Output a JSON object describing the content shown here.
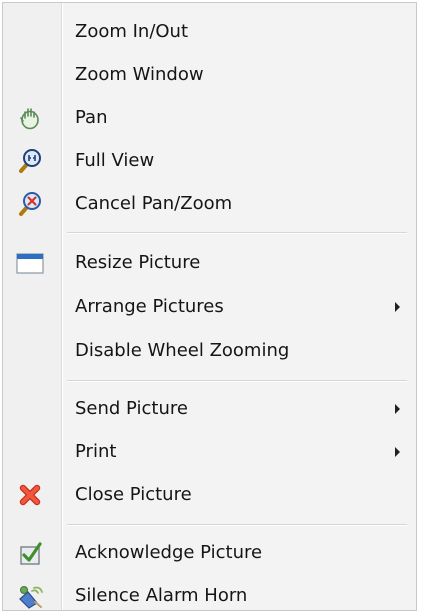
{
  "menu": {
    "items": [
      {
        "label": "Zoom In/Out",
        "icon": null,
        "submenu": false
      },
      {
        "label": "Zoom Window",
        "icon": null,
        "submenu": false
      },
      {
        "label": "Pan",
        "icon": "hand-icon",
        "submenu": false
      },
      {
        "label": "Full View",
        "icon": "full-view-magnifier-icon",
        "submenu": false
      },
      {
        "label": "Cancel Pan/Zoom",
        "icon": "cancel-zoom-magnifier-icon",
        "submenu": false
      },
      {
        "label": "Resize Picture",
        "icon": "window-icon",
        "submenu": false
      },
      {
        "label": "Arrange Pictures",
        "icon": null,
        "submenu": true
      },
      {
        "label": "Disable Wheel Zooming",
        "icon": null,
        "submenu": false
      },
      {
        "label": "Send Picture",
        "icon": null,
        "submenu": true
      },
      {
        "label": "Print",
        "icon": null,
        "submenu": true
      },
      {
        "label": "Close Picture",
        "icon": "close-x-icon",
        "submenu": false
      },
      {
        "label": "Acknowledge Picture",
        "icon": "acknowledge-check-icon",
        "submenu": false
      },
      {
        "label": "Silence Alarm Horn",
        "icon": "alarm-horn-icon",
        "submenu": false
      }
    ]
  },
  "colors": {
    "close_red": "#e8452c",
    "acknowledge_green": "#5aa83a",
    "window_blue": "#2f6fc2"
  }
}
